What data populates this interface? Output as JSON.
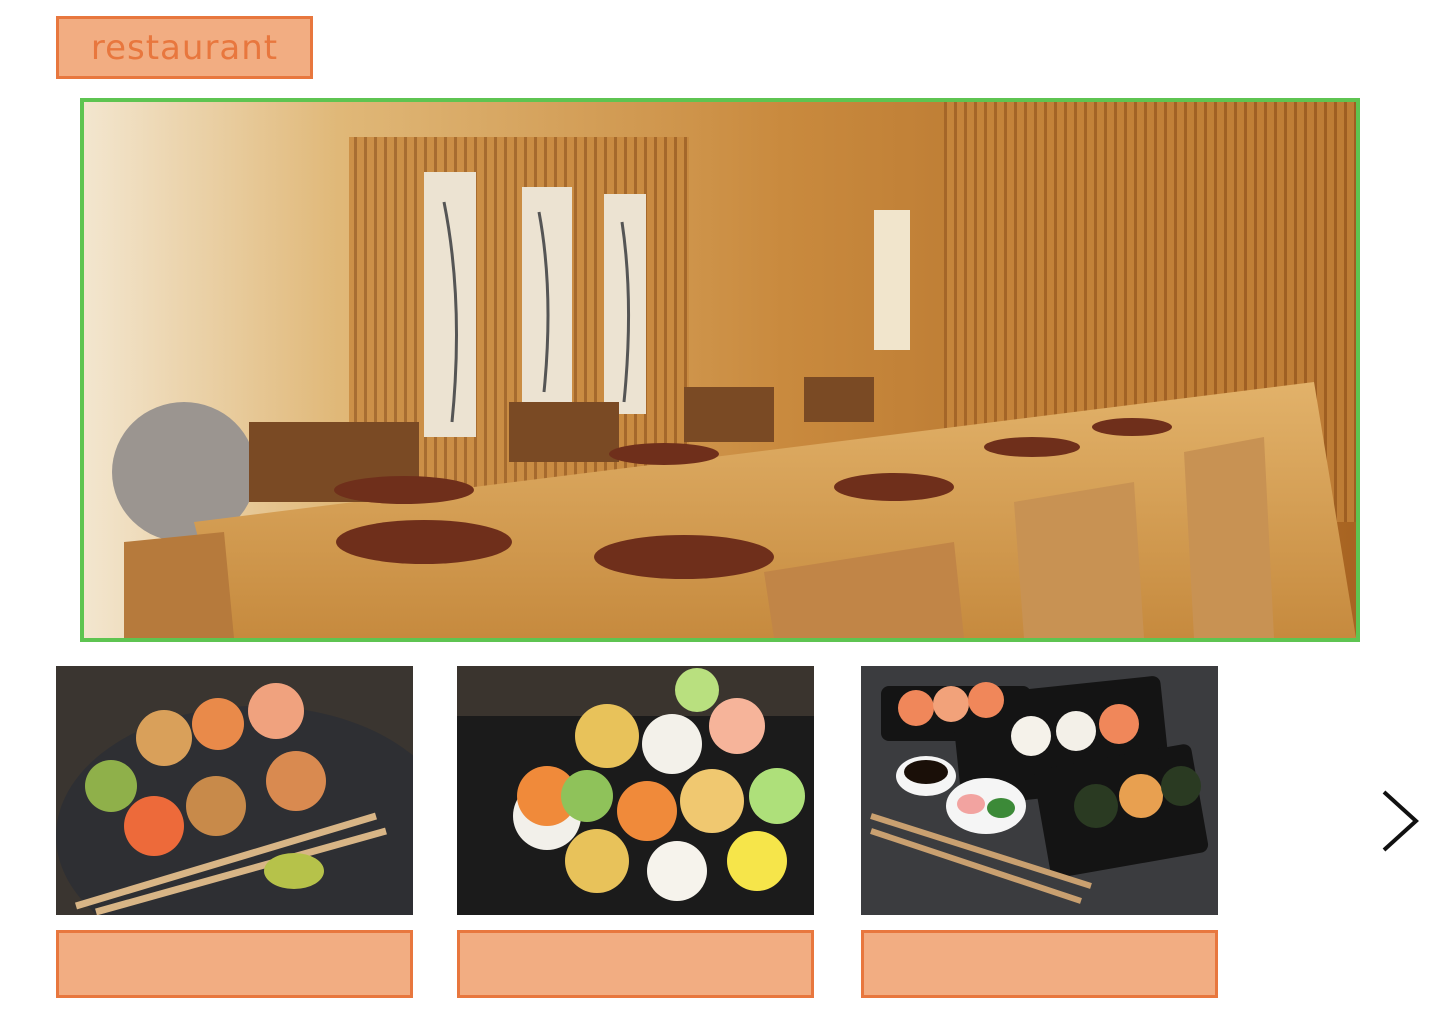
{
  "header": {
    "tag_label": "restaurant"
  },
  "hero": {
    "icon": "restaurant-interior-photo"
  },
  "gallery": {
    "items": [
      {
        "icon": "sushi-rolls-photo",
        "caption": ""
      },
      {
        "icon": "temari-sushi-photo",
        "caption": ""
      },
      {
        "icon": "sushi-platter-photo",
        "caption": ""
      }
    ],
    "next_icon": "chevron-right-icon"
  },
  "colors": {
    "accent": "#e8773e",
    "accent_fill": "#f2ad82",
    "frame": "#5ec451"
  }
}
